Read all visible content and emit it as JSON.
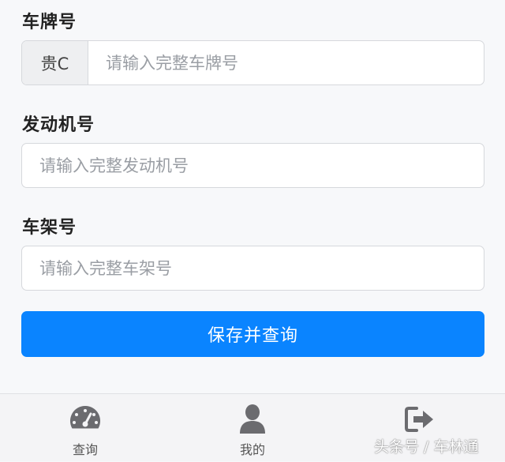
{
  "form": {
    "plate": {
      "label": "车牌号",
      "prefix": "贵C",
      "placeholder": "请输入完整车牌号"
    },
    "engine": {
      "label": "发动机号",
      "placeholder": "请输入完整发动机号"
    },
    "vin": {
      "label": "车架号",
      "placeholder": "请输入完整车架号"
    },
    "submit_label": "保存并查询"
  },
  "tabbar": {
    "items": [
      {
        "label": "查询",
        "icon": "dashboard-icon"
      },
      {
        "label": "我的",
        "icon": "user-icon"
      },
      {
        "label": "",
        "icon": "logout-icon"
      }
    ]
  },
  "watermark": "头条号 / 车林通",
  "colors": {
    "primary": "#0a84ff",
    "background": "#f7f8fa",
    "border": "#d6d8dc",
    "icon": "#6b6b6f"
  }
}
